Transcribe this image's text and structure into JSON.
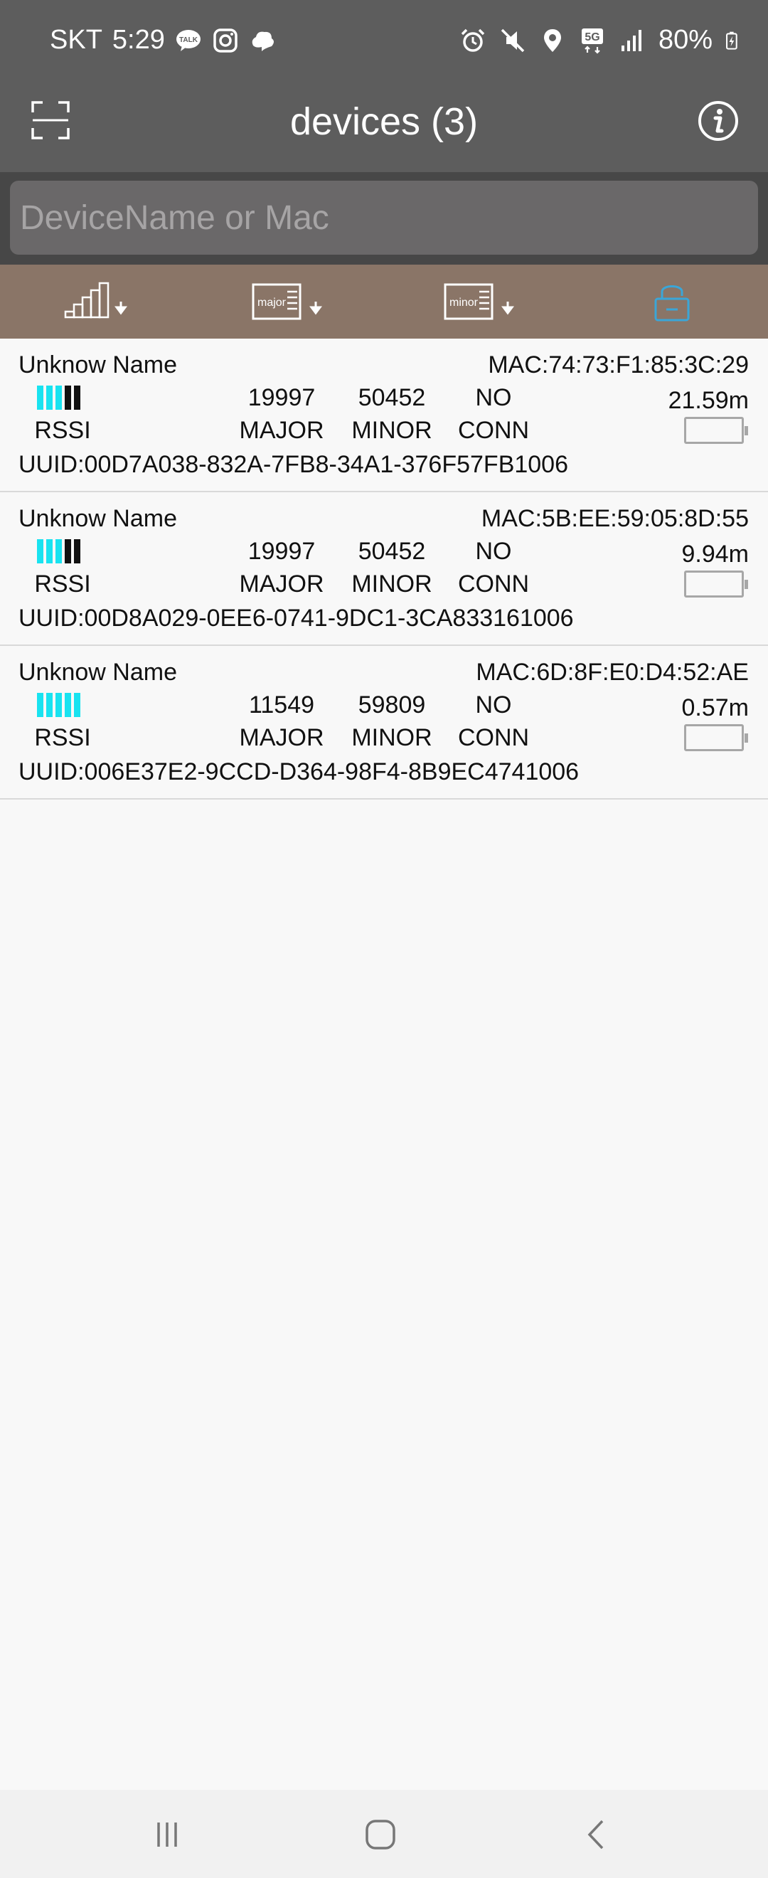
{
  "status_bar": {
    "carrier": "SKT",
    "time": "5:29",
    "battery_percent": "80%",
    "left_icons": [
      "kakaotalk-icon",
      "instagram-icon",
      "cloud-app-icon"
    ],
    "right_icons": [
      "alarm-icon",
      "mute-icon",
      "location-icon",
      "5g-icon",
      "signal-icon",
      "battery-charging-icon"
    ]
  },
  "toolbar": {
    "title": "devices (3)",
    "left_icon": "scan-icon",
    "right_icon": "info-icon"
  },
  "search": {
    "placeholder": "DeviceName or Mac",
    "value": ""
  },
  "sort_bar": {
    "buttons": [
      {
        "name": "sort-rssi",
        "icon": "signal-bars-icon",
        "label": ""
      },
      {
        "name": "sort-major",
        "icon": "major-card-icon",
        "label": "major"
      },
      {
        "name": "sort-minor",
        "icon": "minor-card-icon",
        "label": "minor"
      },
      {
        "name": "filter-connectable",
        "icon": "lock-icon",
        "label": ""
      }
    ],
    "colors": {
      "background": "#8a7567",
      "icon": "#ffffff",
      "active": "#3aa6d8"
    }
  },
  "devices": [
    {
      "name": "Unknow Name",
      "mac": "MAC:74:73:F1:85:3C:29",
      "rssi_level": 3,
      "rssi_max": 5,
      "major": "19997",
      "minor": "50452",
      "conn": "NO",
      "distance": "21.59m",
      "uuid": "UUID:00D7A038-832A-7FB8-34A1-376F57FB1006"
    },
    {
      "name": "Unknow Name",
      "mac": "MAC:5B:EE:59:05:8D:55",
      "rssi_level": 3,
      "rssi_max": 5,
      "major": "19997",
      "minor": "50452",
      "conn": "NO",
      "distance": "9.94m",
      "uuid": "UUID:00D8A029-0EE6-0741-9DC1-3CA833161006"
    },
    {
      "name": "Unknow Name",
      "mac": "MAC:6D:8F:E0:D4:52:AE",
      "rssi_level": 5,
      "rssi_max": 5,
      "major": "11549",
      "minor": "59809",
      "conn": "NO",
      "distance": "0.57m",
      "uuid": "UUID:006E37E2-9CCD-D364-98F4-8B9EC4741006"
    }
  ],
  "labels": {
    "rssi": "RSSI",
    "major": "MAJOR",
    "minor": "MINOR",
    "conn": "CONN"
  },
  "nav_bar": {
    "buttons": [
      "recents-icon",
      "home-icon",
      "back-icon"
    ]
  },
  "colors": {
    "header": "#5d5d5d",
    "search_bg": "#474747",
    "rssi_on": "#19e3f0",
    "rssi_off": "#111111"
  }
}
